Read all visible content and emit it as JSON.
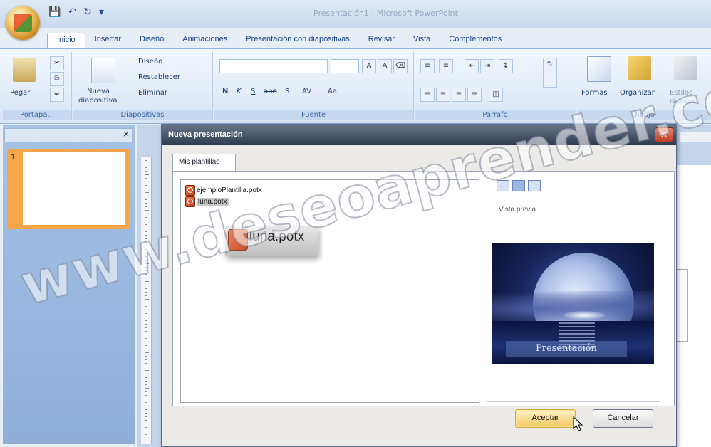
{
  "app": {
    "window_title": "Presentación1 - Microsoft PowerPoint"
  },
  "ribbon": {
    "tabs": [
      {
        "label": "Inicio"
      },
      {
        "label": "Insertar"
      },
      {
        "label": "Diseño"
      },
      {
        "label": "Animaciones"
      },
      {
        "label": "Presentación con diapositivas"
      },
      {
        "label": "Revisar"
      },
      {
        "label": "Vista"
      },
      {
        "label": "Complementos"
      }
    ],
    "groups": {
      "clipboard": {
        "label": "Portapa...",
        "paste": "Pegar"
      },
      "slides": {
        "label": "Diapositivas",
        "new_slide_1": "Nueva",
        "new_slide_2": "diapositiva",
        "layout": "Diseño",
        "reset": "Restablecer",
        "delete": "Eliminar"
      },
      "font": {
        "label": "Fuente",
        "bold": "N",
        "italic": "K",
        "underline": "S",
        "strike": "abe",
        "shadow": "S",
        "spacing": "AV",
        "case": "Aa"
      },
      "paragraph": {
        "label": "Párrafo"
      },
      "drawing": {
        "label": "Dibujo",
        "shapes": "Formas",
        "arrange": "Organizar",
        "quick_styles_1": "Estilos",
        "quick_styles_2": "rápidos"
      }
    }
  },
  "dialog": {
    "title": "Nueva presentación",
    "tab": "Mis plantillas",
    "files": [
      {
        "name": "ejemploPlantilla.potx"
      },
      {
        "name": "luna.potx"
      }
    ],
    "drag_label": "luna.potx",
    "preview_label": "Vista previa",
    "preview_caption": "Presentación",
    "ok_label": "Aceptar",
    "cancel_label": "Cancelar"
  },
  "watermark": "www.deseoaprender.com",
  "colors": {
    "dialog_title_bg": "#2e3a4f",
    "ok_button": "#f5c760",
    "slide_thumb_selected": "#f7a64a"
  }
}
